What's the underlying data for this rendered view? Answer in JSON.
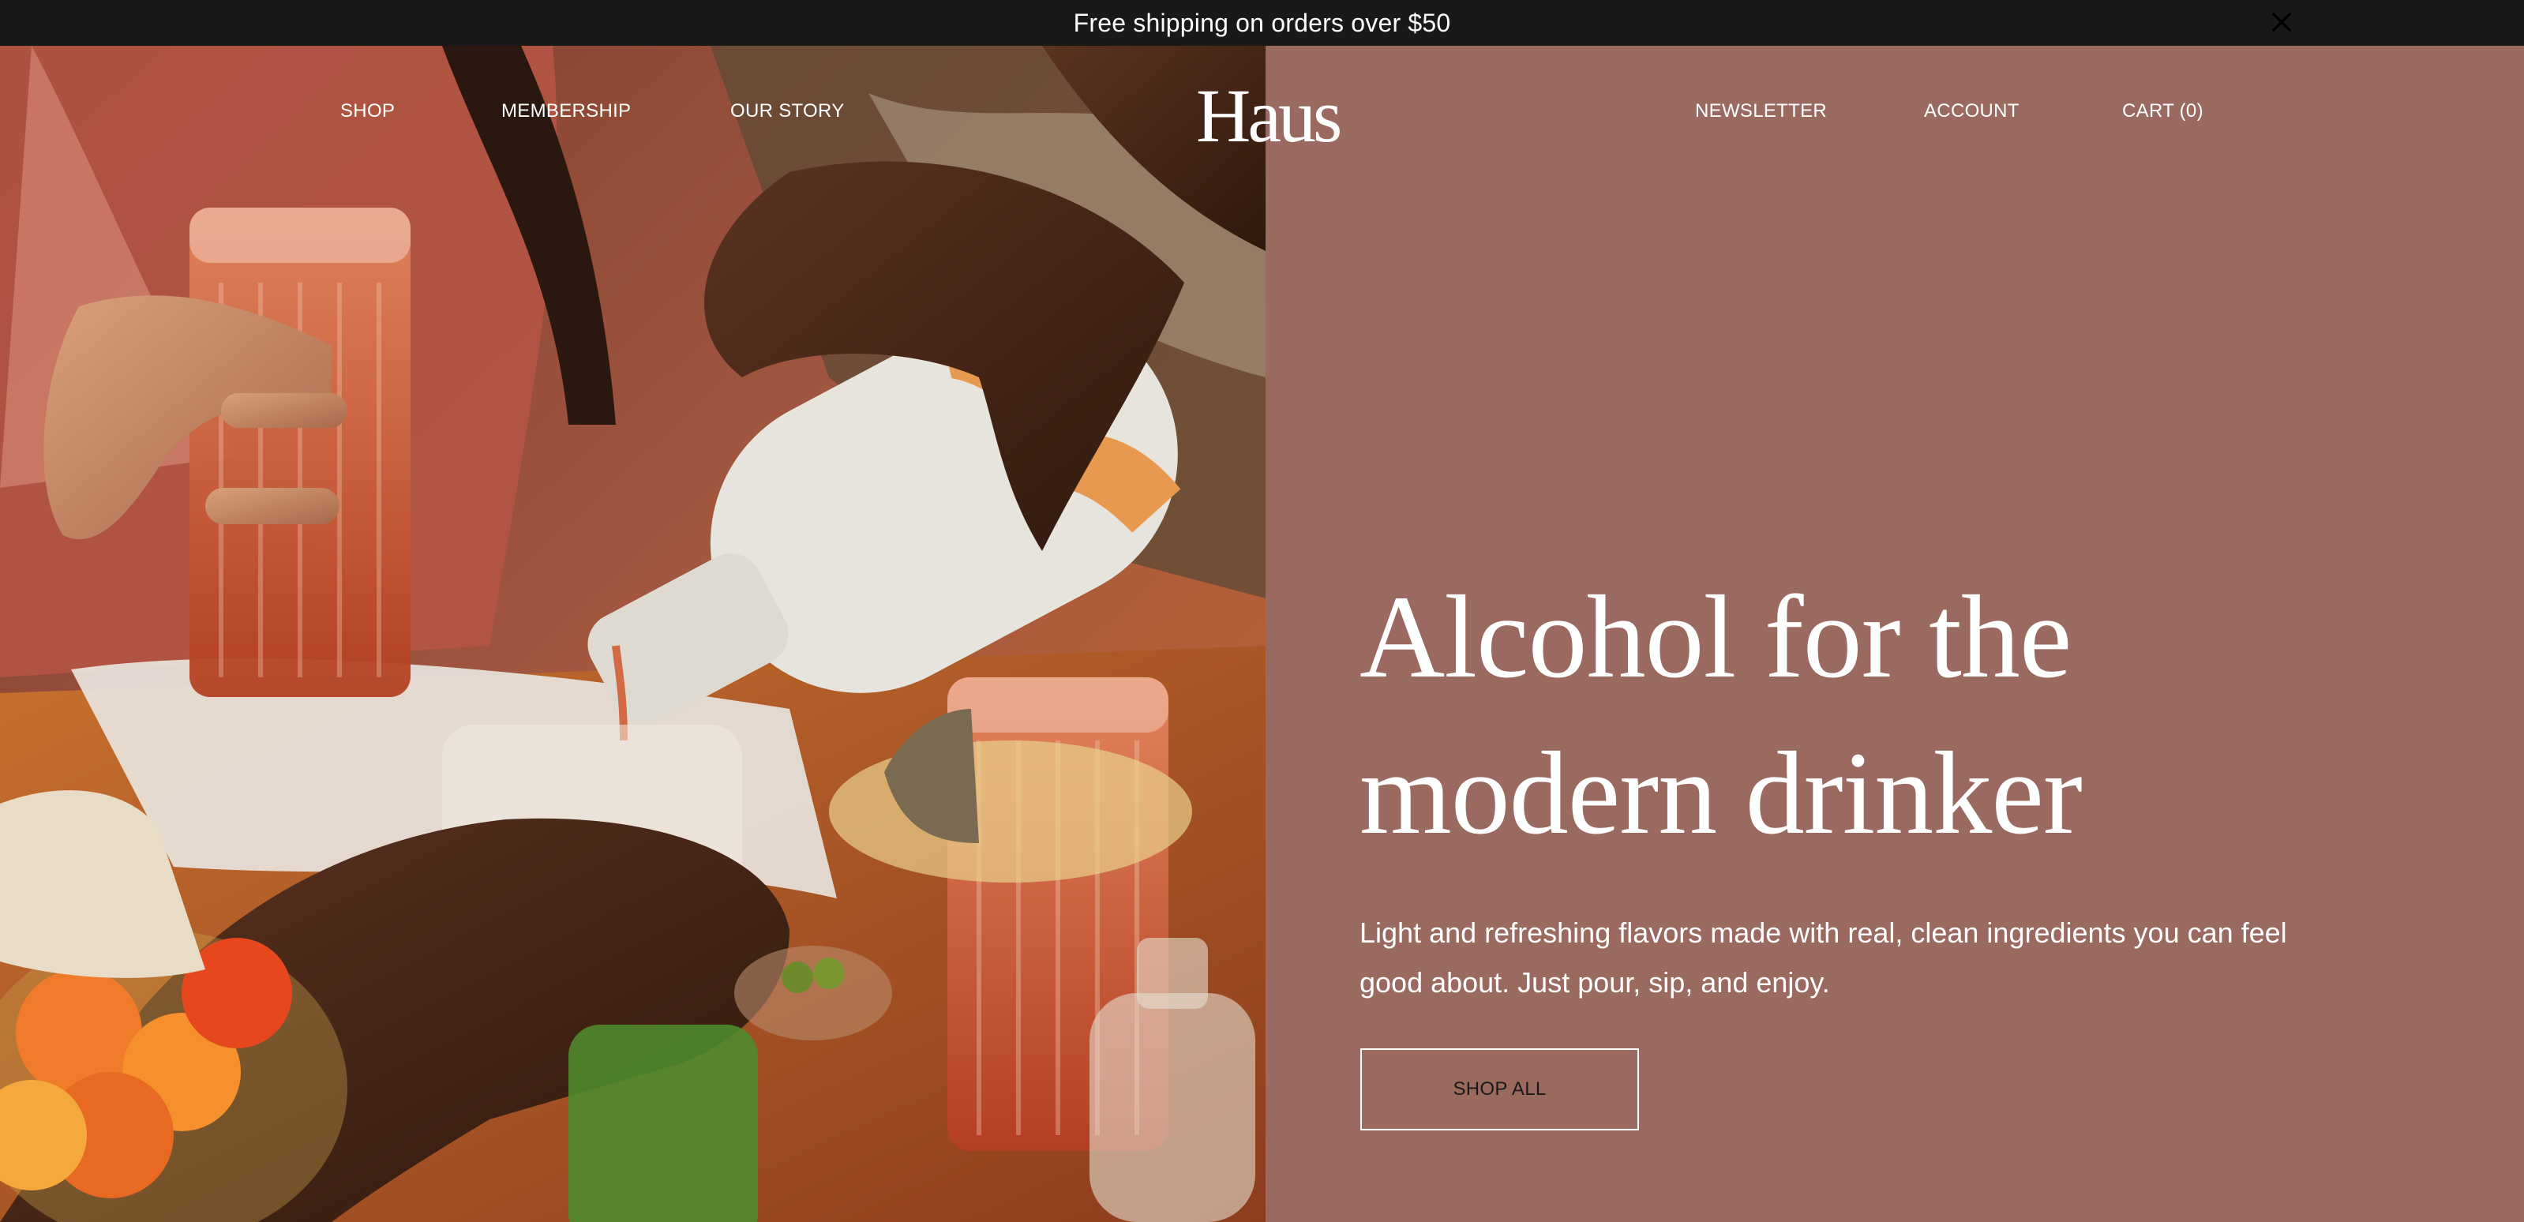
{
  "announcement": {
    "text": "Free shipping on orders over $50",
    "close_icon": "close-icon"
  },
  "nav": {
    "left": [
      "SHOP",
      "MEMBERSHIP",
      "OUR STORY"
    ],
    "right": [
      "NEWSLETTER",
      "ACCOUNT",
      "CART (0)"
    ],
    "logo": "Haus"
  },
  "hero": {
    "headline": "Alcohol for the modern drinker",
    "subtext": "Light and refreshing flavors made with real, clean ingredients you can feel good about. Just pour, sip, and enjoy.",
    "cta_label": "SHOP ALL",
    "image_description_icon": "hero-photo"
  },
  "colors": {
    "announcement_bg": "#191919",
    "hero_panel": "#9a6a60",
    "text": "#ffffff"
  }
}
